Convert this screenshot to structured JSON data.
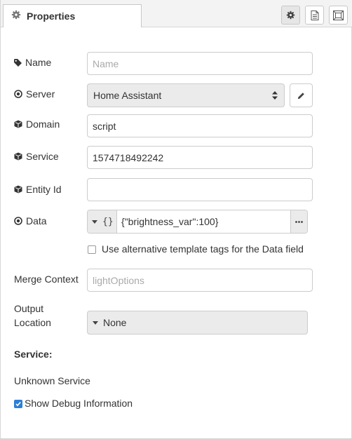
{
  "tab": {
    "label": "Properties"
  },
  "toolbar": {
    "settings_icon": "gear-icon",
    "description_icon": "document-icon",
    "appearance_icon": "frame-icon"
  },
  "form": {
    "name": {
      "label": "Name",
      "placeholder": "Name",
      "value": ""
    },
    "server": {
      "label": "Server",
      "value": "Home Assistant"
    },
    "domain": {
      "label": "Domain",
      "value": "script"
    },
    "service": {
      "label": "Service",
      "value": "1574718492242"
    },
    "entity_id": {
      "label": "Entity Id",
      "value": ""
    },
    "data": {
      "label": "Data",
      "type_symbol": "{}",
      "value": "{\"brightness_var\":100}",
      "more": "..."
    },
    "alt_template": {
      "label": "Use alternative template tags for the Data field",
      "checked": false
    },
    "merge_context": {
      "label": "Merge Context",
      "placeholder": "lightOptions",
      "value": ""
    },
    "output_location": {
      "label_line1": "Output",
      "label_line2": "Location",
      "value": "None"
    },
    "service_info": {
      "heading": "Service:",
      "text": "Unknown Service"
    },
    "debug": {
      "label": "Show Debug Information",
      "checked": true
    }
  },
  "colors": {
    "accent": "#2c7fd8",
    "border": "#cccccc",
    "field_bg": "#ebebeb"
  }
}
